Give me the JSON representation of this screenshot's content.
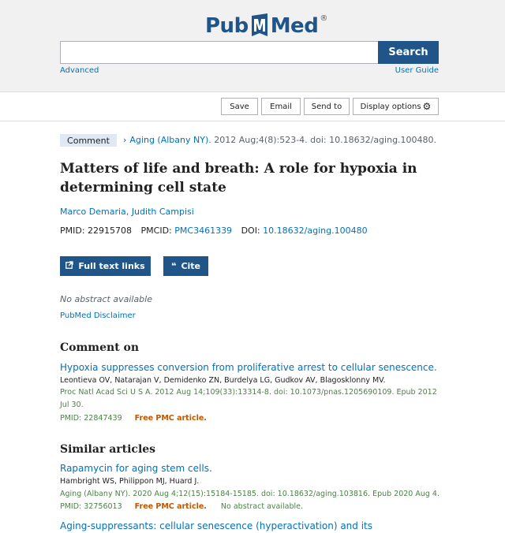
{
  "header": {
    "logo_pub": "Pub",
    "logo_med": "Med",
    "logo_reg": "®",
    "search_button": "Search",
    "advanced_link": "Advanced",
    "user_guide_link": "User Guide",
    "search_value": "",
    "search_placeholder": ""
  },
  "toolbar": {
    "save": "Save",
    "email": "Email",
    "send_to": "Send to",
    "display_options": "Display options"
  },
  "article": {
    "badge": "Comment",
    "journal": "Aging (Albany NY).",
    "citation_rest": "2012 Aug;4(8):523-4. doi: 10.18632/aging.100480.",
    "title": "Matters of life and breath: A role for hypoxia in determining cell state",
    "authors": [
      "Marco Demaria",
      "Judith Campisi"
    ],
    "pmid_label": "PMID: 22915708",
    "pmcid_label": "PMCID:",
    "pmcid_value": "PMC3461339",
    "doi_label": "DOI:",
    "doi_value": "10.18632/aging.100480",
    "full_text_button": "Full text links",
    "cite_button": "Cite",
    "no_abstract": "No abstract available",
    "disclaimer": "PubMed Disclaimer"
  },
  "comment_on": {
    "heading": "Comment on",
    "title": "Hypoxia suppresses conversion from proliferative arrest to cellular senescence.",
    "authors": "Leontieva OV, Natarajan V, Demidenko ZN, Burdelya LG, Gudkov AV, Blagosklonny MV.",
    "citation": "Proc Natl Acad Sci U S A. 2012 Aug 14;109(33):13314-8. doi: 10.1073/pnas.1205690109. Epub 2012 Jul 30.",
    "pmid": "PMID: 22847439",
    "free": "Free PMC article."
  },
  "similar": {
    "heading": "Similar articles",
    "items": [
      {
        "title": "Rapamycin for aging stem cells.",
        "authors": "Hambright WS, Philippon MJ, Huard J.",
        "citation": "Aging (Albany NY). 2020 Aug 4;12(15):15184-15185. doi: 10.18632/aging.103816. Epub 2020 Aug 4.",
        "pmid": "PMID: 32756013",
        "free": "Free PMC article.",
        "note": "No abstract available."
      },
      {
        "title": "Aging-suppressants: cellular senescence (hyperactivation) and its"
      }
    ]
  },
  "colors": {
    "brand": "#20558a",
    "link": "#0071bc",
    "citation_green": "#4a8246",
    "free_orange": "#c05600",
    "badge_bg": "#dfe8f4"
  },
  "icons": [
    "external-link-icon",
    "quote-icon",
    "gear-icon",
    "chevron-right-icon",
    "pubmed-logo"
  ]
}
